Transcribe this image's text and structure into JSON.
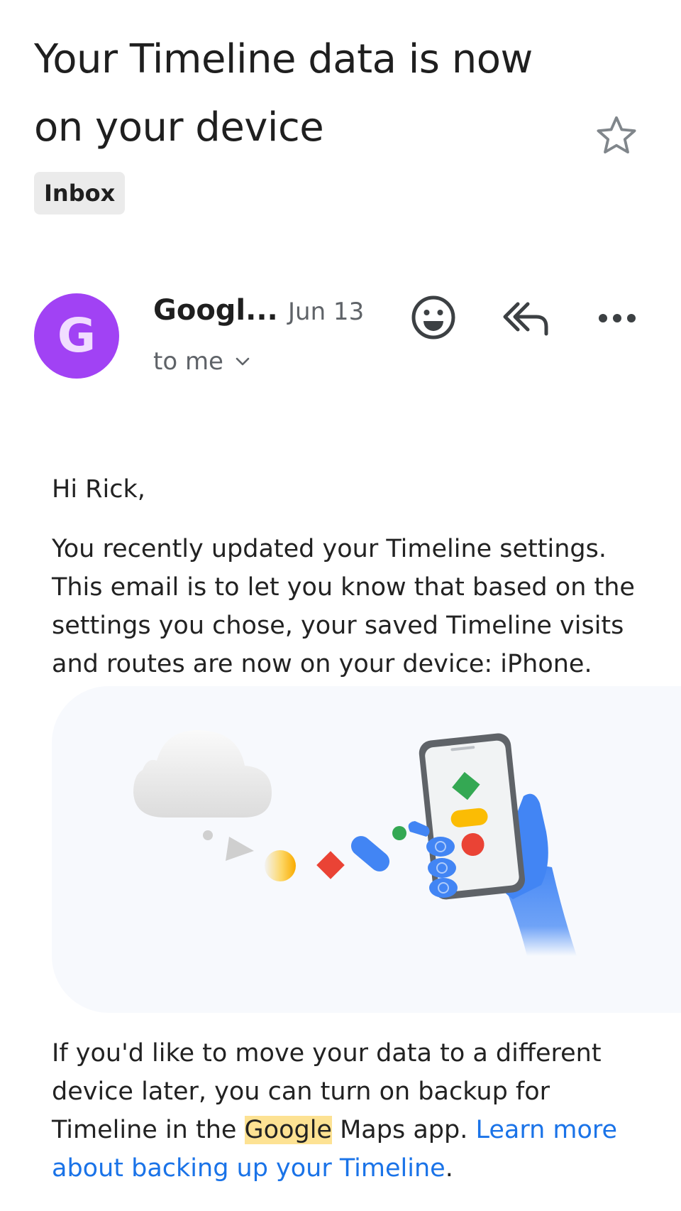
{
  "email": {
    "subject": "Your Timeline data is now on your device",
    "label": "Inbox",
    "sender_initial": "G",
    "sender_name": "Googl...",
    "date": "Jun 13",
    "recipient": "to me",
    "greeting": "Hi Rick,",
    "paragraph1": "You recently updated your Timeline settings. This email is to let you know that based on the settings you chose, your saved Timeline visits and routes are now on your device: iPhone.",
    "paragraph2_before": "If you'd like to move your data to a different device later, you can turn on backup for Timeline in the ",
    "paragraph2_highlight": "Google",
    "paragraph2_after": " Maps app. ",
    "link_text": "Learn more about backing up your Timeline",
    "paragraph2_end": "."
  },
  "icons": {
    "star": "star-outline-icon",
    "emoji": "add-reaction-icon",
    "reply": "reply-all-icon",
    "more": "more-horizontal-icon",
    "chevron": "chevron-down-icon"
  },
  "colors": {
    "avatar": "#a142f4",
    "link": "#1a73e8",
    "highlight": "#fde293"
  }
}
